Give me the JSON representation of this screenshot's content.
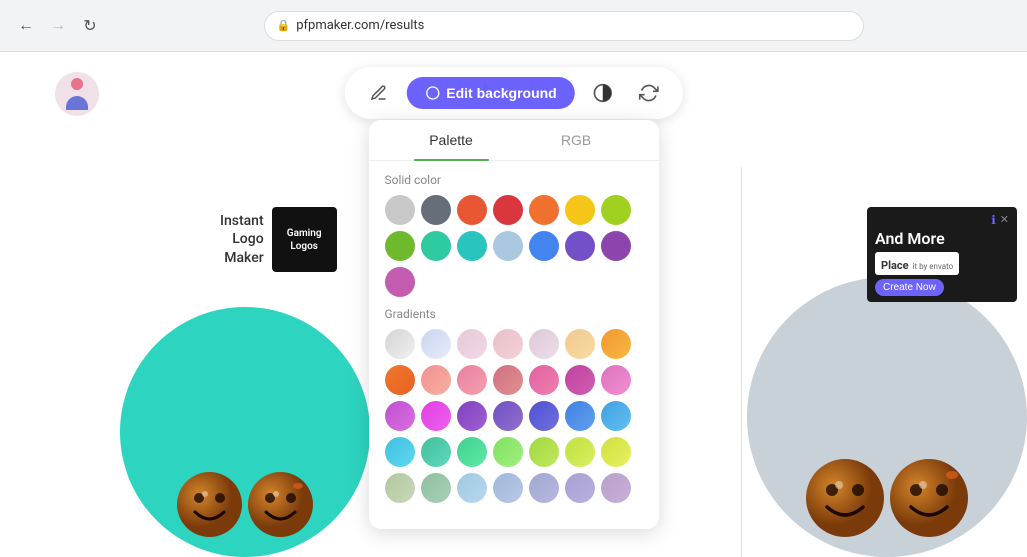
{
  "browser": {
    "url": "pfpmaker.com/results",
    "back_disabled": false,
    "forward_disabled": true
  },
  "toolbar": {
    "edit_bg_label": "Edit background",
    "pencil_icon": "✏",
    "droplet_icon": "💧",
    "contrast_icon": "◑",
    "refresh_icon": "↺"
  },
  "panel": {
    "tab_palette": "Palette",
    "tab_rgb": "RGB",
    "active_tab": "palette",
    "solid_color_label": "Solid color",
    "gradients_label": "Gradients",
    "solid_colors": [
      "#c8c8c8",
      "#666e7a",
      "#e85634",
      "#d9363e",
      "#f07030",
      "#f5c518",
      "#a0d020",
      "#6fba2c",
      "#2ecba0",
      "#29c4bd",
      "#aac8e0",
      "#4484f0",
      "#7450c8",
      "#8e44ad",
      "#c45cb0"
    ],
    "gradient_swatches": [
      {
        "id": 1,
        "colors": [
          "#d4d4d4",
          "#f0f0f0"
        ]
      },
      {
        "id": 2,
        "colors": [
          "#c8d4f0",
          "#e8ecf8"
        ]
      },
      {
        "id": 3,
        "colors": [
          "#e8c8d8",
          "#f0d8e8"
        ]
      },
      {
        "id": 4,
        "colors": [
          "#e8c0c8",
          "#f4d0d8"
        ]
      },
      {
        "id": 5,
        "colors": [
          "#e0c8d8",
          "#ecdce8"
        ]
      },
      {
        "id": 6,
        "colors": [
          "#f0c890",
          "#f8dca0"
        ]
      },
      {
        "id": 7,
        "colors": [
          "#f09830",
          "#f8b840"
        ]
      },
      {
        "id": 8,
        "colors": [
          "#f07830",
          "#e86020"
        ]
      },
      {
        "id": 9,
        "colors": [
          "#f09090",
          "#f8b0a0"
        ]
      },
      {
        "id": 10,
        "colors": [
          "#e880a0",
          "#f4a0b0"
        ]
      },
      {
        "id": 11,
        "colors": [
          "#d07080",
          "#e09090"
        ]
      },
      {
        "id": 12,
        "colors": [
          "#e060a0",
          "#f080b0"
        ]
      },
      {
        "id": 13,
        "colors": [
          "#c040a0",
          "#d060b0"
        ]
      },
      {
        "id": 14,
        "colors": [
          "#e070c0",
          "#f090d0"
        ]
      },
      {
        "id": 15,
        "colors": [
          "#c050d0",
          "#d870e0"
        ]
      },
      {
        "id": 16,
        "colors": [
          "#e040e0",
          "#f060f0"
        ]
      },
      {
        "id": 17,
        "colors": [
          "#8040c0",
          "#a060d0"
        ]
      },
      {
        "id": 18,
        "colors": [
          "#7050c0",
          "#9070d0"
        ]
      },
      {
        "id": 19,
        "colors": [
          "#5050d0",
          "#7070e0"
        ]
      },
      {
        "id": 20,
        "colors": [
          "#4080e0",
          "#60a0f0"
        ]
      },
      {
        "id": 21,
        "colors": [
          "#40a0e0",
          "#60c0f0"
        ]
      },
      {
        "id": 22,
        "colors": [
          "#40c0e0",
          "#60d8f0"
        ]
      },
      {
        "id": 23,
        "colors": [
          "#40c0a0",
          "#60d8b8"
        ]
      },
      {
        "id": 24,
        "colors": [
          "#40d090",
          "#60e8a8"
        ]
      },
      {
        "id": 25,
        "colors": [
          "#80e060",
          "#a0f080"
        ]
      },
      {
        "id": 26,
        "colors": [
          "#a0d840",
          "#c0e860"
        ]
      },
      {
        "id": 27,
        "colors": [
          "#c0e040",
          "#d8f060"
        ]
      },
      {
        "id": 28,
        "colors": [
          "#d0e040",
          "#e8f060"
        ]
      },
      {
        "id": 29,
        "colors": [
          "#b0c8a0",
          "#c8d8b8"
        ]
      },
      {
        "id": 30,
        "colors": [
          "#90c0a0",
          "#a8d0b8"
        ]
      },
      {
        "id": 31,
        "colors": [
          "#a0c8e0",
          "#b8d8f0"
        ]
      },
      {
        "id": 32,
        "colors": [
          "#a0b8d8",
          "#b8c8e8"
        ]
      },
      {
        "id": 33,
        "colors": [
          "#a0a8d0",
          "#b8b8e0"
        ]
      },
      {
        "id": 34,
        "colors": [
          "#a8a0d0",
          "#b8b0e0"
        ]
      },
      {
        "id": 35,
        "colors": [
          "#b8a0c8",
          "#c8b0d8"
        ]
      }
    ]
  },
  "left_promo": {
    "instant_logo_text": "Instant\nLogo\nMaker",
    "gaming_label": "Gaming",
    "logos_label": "Logos"
  },
  "ad": {
    "and_more_text": "And More",
    "brand": "Place",
    "brand_suffix": "it by envato",
    "cta": "Create Now"
  },
  "avatars": {
    "left_bg_color": "#2dd4bf",
    "right_bg_color": "#c8d0d8"
  }
}
